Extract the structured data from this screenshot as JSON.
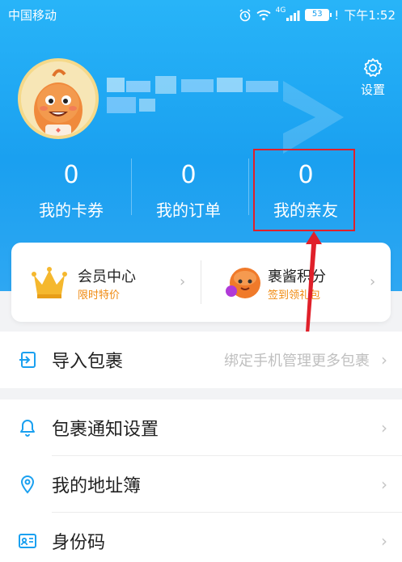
{
  "status_bar": {
    "carrier": "中国移动",
    "network": "4G",
    "battery": "53",
    "alert": "!",
    "time": "下午1:52"
  },
  "header": {
    "settings_label": "设置",
    "avatar_icon": "cartoon-avatar",
    "colors": {
      "gradient_top": "#28b4f8",
      "gradient_bottom": "#1aa0f0",
      "highlight": "#e0202a"
    }
  },
  "stats": [
    {
      "value": "0",
      "label": "我的卡券"
    },
    {
      "value": "0",
      "label": "我的订单"
    },
    {
      "value": "0",
      "label": "我的亲友"
    }
  ],
  "member_card": {
    "left": {
      "title": "会员中心",
      "subtitle": "限时特价",
      "icon": "crown-icon"
    },
    "right": {
      "title": "裹酱积分",
      "subtitle": "签到领礼包",
      "icon": "mascot-icon"
    },
    "subtitle_color": "#f08a10"
  },
  "menu": {
    "import": {
      "label": "导入包裹",
      "hint": "绑定手机管理更多包裹",
      "icon": "import-icon"
    },
    "items": [
      {
        "label": "包裹通知设置",
        "icon": "bell-icon"
      },
      {
        "label": "我的地址簿",
        "icon": "location-pin-icon"
      },
      {
        "label": "身份码",
        "icon": "id-card-icon"
      }
    ]
  }
}
